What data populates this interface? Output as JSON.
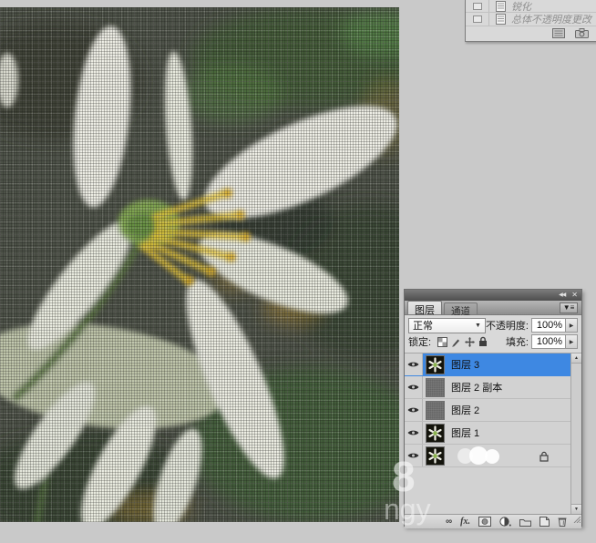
{
  "app": {
    "background_color": "#c9c9c9"
  },
  "canvas": {
    "description": "white flower photo with canvas texture filter"
  },
  "history_panel": {
    "items": [
      {
        "label": "锐化"
      },
      {
        "label": "总体不透明度更改"
      }
    ]
  },
  "layers_panel": {
    "window_buttons": {
      "collapse": "◀◀",
      "close": "✕"
    },
    "tabs": [
      {
        "label": "图层"
      },
      {
        "label": "通道"
      }
    ],
    "panel_menu_glyph": "▼≡",
    "blend_mode": {
      "value": "正常",
      "arrow": "▼"
    },
    "opacity": {
      "label": "不透明度:",
      "value": "100%",
      "spinner": "▶"
    },
    "lock": {
      "label": "锁定:"
    },
    "fill": {
      "label": "填充:",
      "value": "100%",
      "spinner": "▶"
    },
    "layers": [
      {
        "name": "图层 3",
        "selected": true,
        "visible": true,
        "thumb": "flower"
      },
      {
        "name": "图层 2 副本",
        "selected": false,
        "visible": true,
        "thumb": "gray"
      },
      {
        "name": "图层 2",
        "selected": false,
        "visible": true,
        "thumb": "gray"
      },
      {
        "name": "图层 1",
        "selected": false,
        "visible": true,
        "thumb": "flower"
      },
      {
        "name": "",
        "selected": false,
        "visible": true,
        "thumb": "flower",
        "locked": true
      }
    ],
    "scrollbar": {
      "up": "▲",
      "down": "▼"
    },
    "bottom_bar": {
      "link": "∞",
      "fx": "fx."
    }
  },
  "watermark": {
    "big": "8",
    "text": "ngy"
  },
  "colors": {
    "selection_blue": "#3e88e2",
    "panel_bg": "#d6d6d6",
    "app_bg": "#c9c9c9",
    "photo_base": "#454a40"
  }
}
